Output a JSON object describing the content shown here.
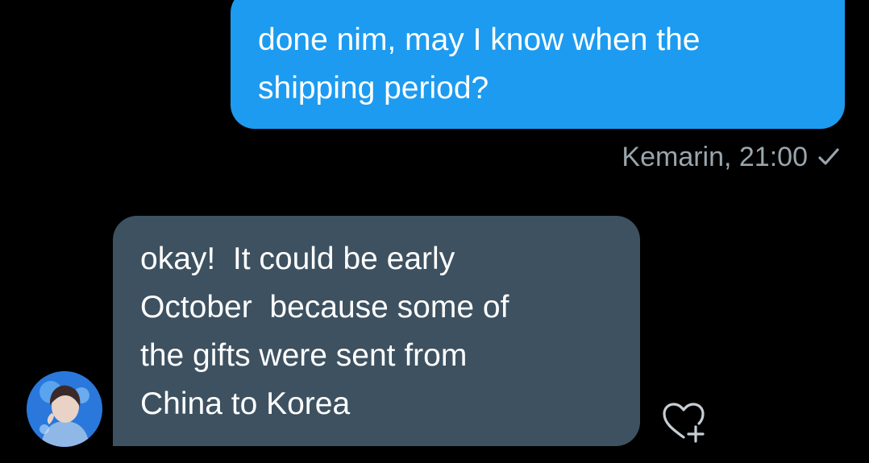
{
  "conversation": {
    "sent_message": {
      "text": "done nim, may I know when the\nshipping period?",
      "timestamp": "Kemarin, 21:00",
      "status_icon": "check-icon",
      "bubble_color": "#1d9bf0"
    },
    "received_message": {
      "text": "okay!  It could be early\nOctober  because some of\nthe gifts were sent from\nChina to Korea",
      "bubble_color": "#3d5160",
      "avatar_icon": "user-avatar",
      "reaction_icon": "heart-plus-icon"
    }
  },
  "colors": {
    "background": "#000000",
    "meta_text": "#9aa5ad",
    "message_text": "#ffffff"
  }
}
